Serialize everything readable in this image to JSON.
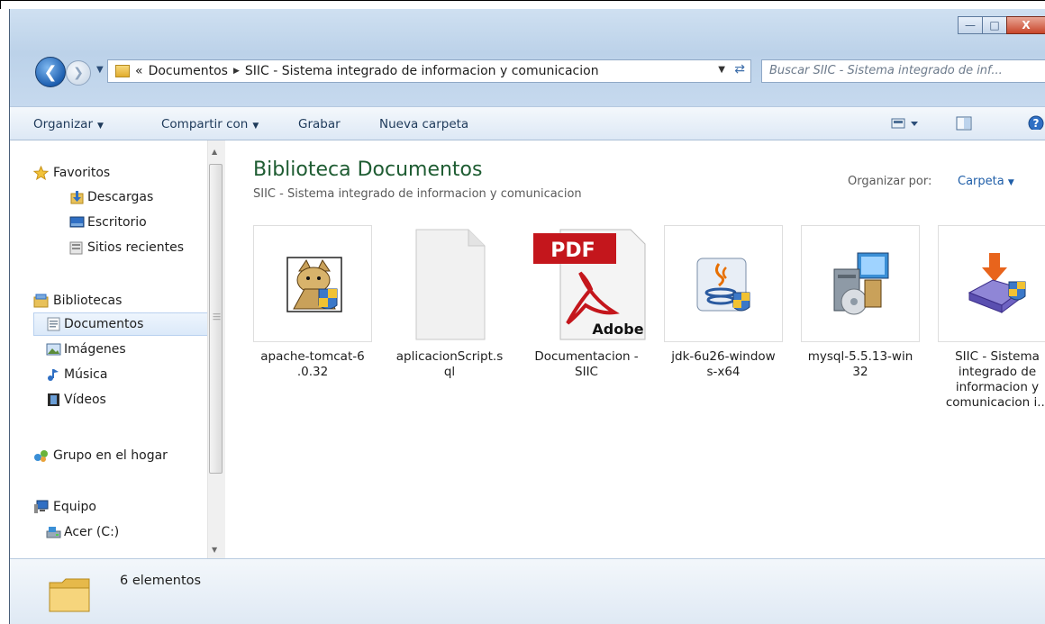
{
  "titlebar": {
    "minimize": "—",
    "maximize": "□",
    "close": "X"
  },
  "address": {
    "crumb_prefix": "«",
    "crumbs": [
      "Documentos",
      "SIIC - Sistema integrado de informacion y comunicacion"
    ],
    "search_placeholder": "Buscar SIIC - Sistema integrado de inf..."
  },
  "toolbar": {
    "organize": "Organizar",
    "share": "Compartir con",
    "burn": "Grabar",
    "new_folder": "Nueva carpeta"
  },
  "sidebar": {
    "favorites": "Favoritos",
    "downloads": "Descargas",
    "desktop": "Escritorio",
    "recent": "Sitios recientes",
    "libraries": "Bibliotecas",
    "documents": "Documentos",
    "images": "Imágenes",
    "music": "Música",
    "videos": "Vídeos",
    "homegroup": "Grupo en el hogar",
    "computer": "Equipo",
    "drive_c": "Acer (C:)"
  },
  "content": {
    "title": "Biblioteca Documentos",
    "subtitle": "SIIC - Sistema integrado de informacion y comunicacion",
    "arrange_label": "Organizar por:",
    "arrange_value": "Carpeta",
    "files": [
      {
        "name": "apache-tomcat-6.0.32",
        "line1": "apache-tomcat-6",
        "line2": ".0.32",
        "icon": "tomcat-installer-icon"
      },
      {
        "name": "aplicacionScript.sql",
        "line1": "aplicacionScript.s",
        "line2": "ql",
        "icon": "blank-file-icon"
      },
      {
        "name": "Documentacion - SIIC",
        "line1": "Documentacion -",
        "line2": "SIIC",
        "icon": "pdf-icon",
        "pdf_badge": "PDF",
        "adobe": "Adobe"
      },
      {
        "name": "jdk-6u26-windows-x64",
        "line1": "jdk-6u26-window",
        "line2": "s-x64",
        "icon": "java-installer-icon"
      },
      {
        "name": "mysql-5.5.13-win32",
        "line1": "mysql-5.5.13-win",
        "line2": "32",
        "icon": "setup-installer-icon"
      },
      {
        "name": "SIIC - Sistema integrado de informacion y comunicacion",
        "line1": "SIIC - Sistema",
        "line2": "integrado de",
        "line3": "informacion y",
        "line4": "comunicacion i...",
        "icon": "msi-installer-icon"
      }
    ]
  },
  "status": {
    "count": "6 elementos"
  }
}
